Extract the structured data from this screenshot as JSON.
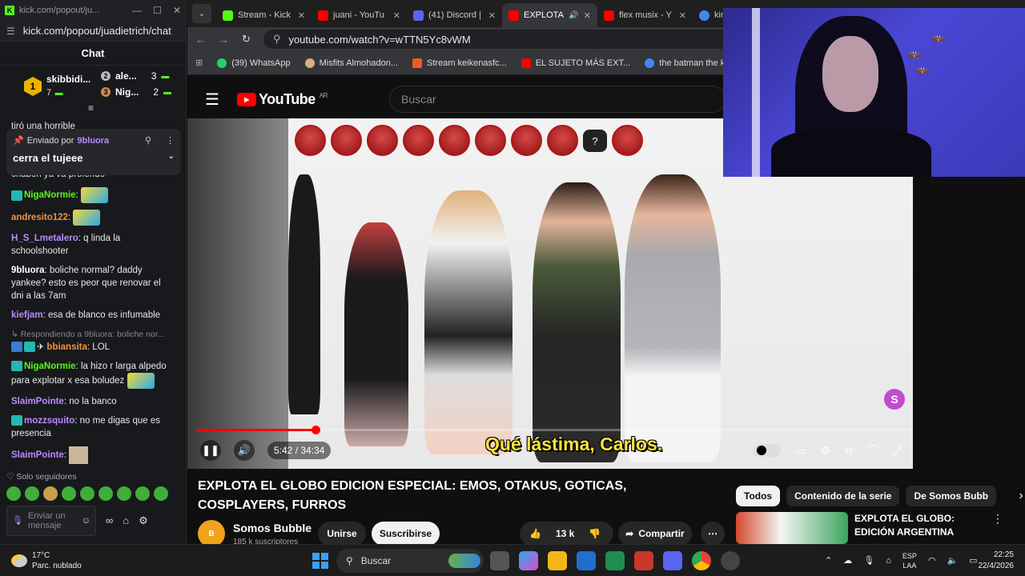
{
  "kick": {
    "titlebar_url": "kick.com/popout/ju...",
    "url": "kick.com/popout/juadietrich/chat",
    "chat_title": "Chat",
    "leaderboard": {
      "first_name": "skibbidi...",
      "first_count": "7",
      "first_rank": "1",
      "second_name": "ale...",
      "second_count": "3",
      "third_name": "Nig...",
      "third_count": "2"
    },
    "pinned": {
      "sent_by_label": "Enviado por",
      "sent_by_user": "9bluora",
      "text": "cerra el tujeee"
    },
    "messages": [
      {
        "user": "",
        "text": "tiró una horrible",
        "color": "#e8e8e8"
      },
      {
        "user": "",
        "text": "chabon ya va profendo",
        "color": "#e8e8e8"
      },
      {
        "user": "NigaNormie",
        "text": "",
        "color": "#53fc18"
      },
      {
        "user": "andresito122",
        "text": "",
        "color": "#f2933a"
      },
      {
        "user": "H_S_Lmetalero",
        "text": "q linda la schoolshooter",
        "color": "#b98bff"
      },
      {
        "user": "9bluora",
        "text": "boliche normal? daddy yankee? esto es peor que renovar el dni a las 7am",
        "color": "#ffffff"
      },
      {
        "user": "kiefjam",
        "text": "esa de blanco es infumable",
        "color": "#b98bff"
      },
      {
        "user": "bbiansita",
        "text": "LOL",
        "color": "#f2933a",
        "reply": "Respondiendo a 9bluora: boliche nor..."
      },
      {
        "user": "NigaNormie",
        "text": "la hizo r larga alpedo para explotar x esa boludez",
        "color": "#53fc18"
      },
      {
        "user": "SlaimPointe",
        "text": "no la banco",
        "color": "#b98bff"
      },
      {
        "user": "mozzsquito",
        "text": "no me digas que es presencia",
        "color": "#b98bff"
      },
      {
        "user": "SlaimPointe",
        "text": "",
        "color": "#b98bff"
      }
    ],
    "followers_only": "Solo seguidores",
    "input_placeholder": "Enviar un mensaje"
  },
  "browser": {
    "tabs": [
      {
        "label": "Stream - Kick",
        "color": "#53fc18"
      },
      {
        "label": "juani - YouTu",
        "color": "#ff0000"
      },
      {
        "label": "(41) Discord |",
        "color": "#5865f2"
      },
      {
        "label": "EXPLOTA",
        "color": "#ff0000",
        "active": true
      },
      {
        "label": "flex musix - Y",
        "color": "#ff0000"
      },
      {
        "label": "kim",
        "color": "#4285f4"
      }
    ],
    "url": "youtube.com/watch?v=wTTN5Yc8vWM",
    "bookmarks": [
      {
        "label": "(39) WhatsApp",
        "color": "#25d366"
      },
      {
        "label": "Misfits Almohadon...",
        "color": "#d9b27c"
      },
      {
        "label": "Stream keikenasfc...",
        "color": "#f15a24"
      },
      {
        "label": "EL SUJETO MÁS EXT...",
        "color": "#ff0000"
      },
      {
        "label": "the batman the killi...",
        "color": "#4285f4"
      }
    ]
  },
  "youtube": {
    "logo_text": "YouTube",
    "country": "AR",
    "search_placeholder": "Buscar",
    "subtitle": "Qué lástima, Carlos.",
    "time": "5:42 / 34:34",
    "progress_fraction": 0.166,
    "title": "EXPLOTA EL GLOBO EDICION ESPECIAL: EMOS, OTAKUS, GOTICAS, COSPLAYERS, FURROS",
    "channel_name": "Somos Bubble",
    "channel_subs": "185 k suscriptores",
    "join_label": "Unirse",
    "subscribe_label": "Suscribirse",
    "likes": "13 k",
    "share_label": "Compartir",
    "chips": [
      "Todos",
      "Contenido de la serie",
      "De Somos Bubb"
    ],
    "rec_title": "EXPLOTA EL GLOBO: EDICIÓN ARGENTINA"
  },
  "taskbar": {
    "temp": "17°C",
    "weather": "Parc. nublado",
    "search": "Buscar",
    "lang_top": "ESP",
    "lang_bottom": "LAA",
    "time": "22:25",
    "date": "22/4/2026"
  }
}
